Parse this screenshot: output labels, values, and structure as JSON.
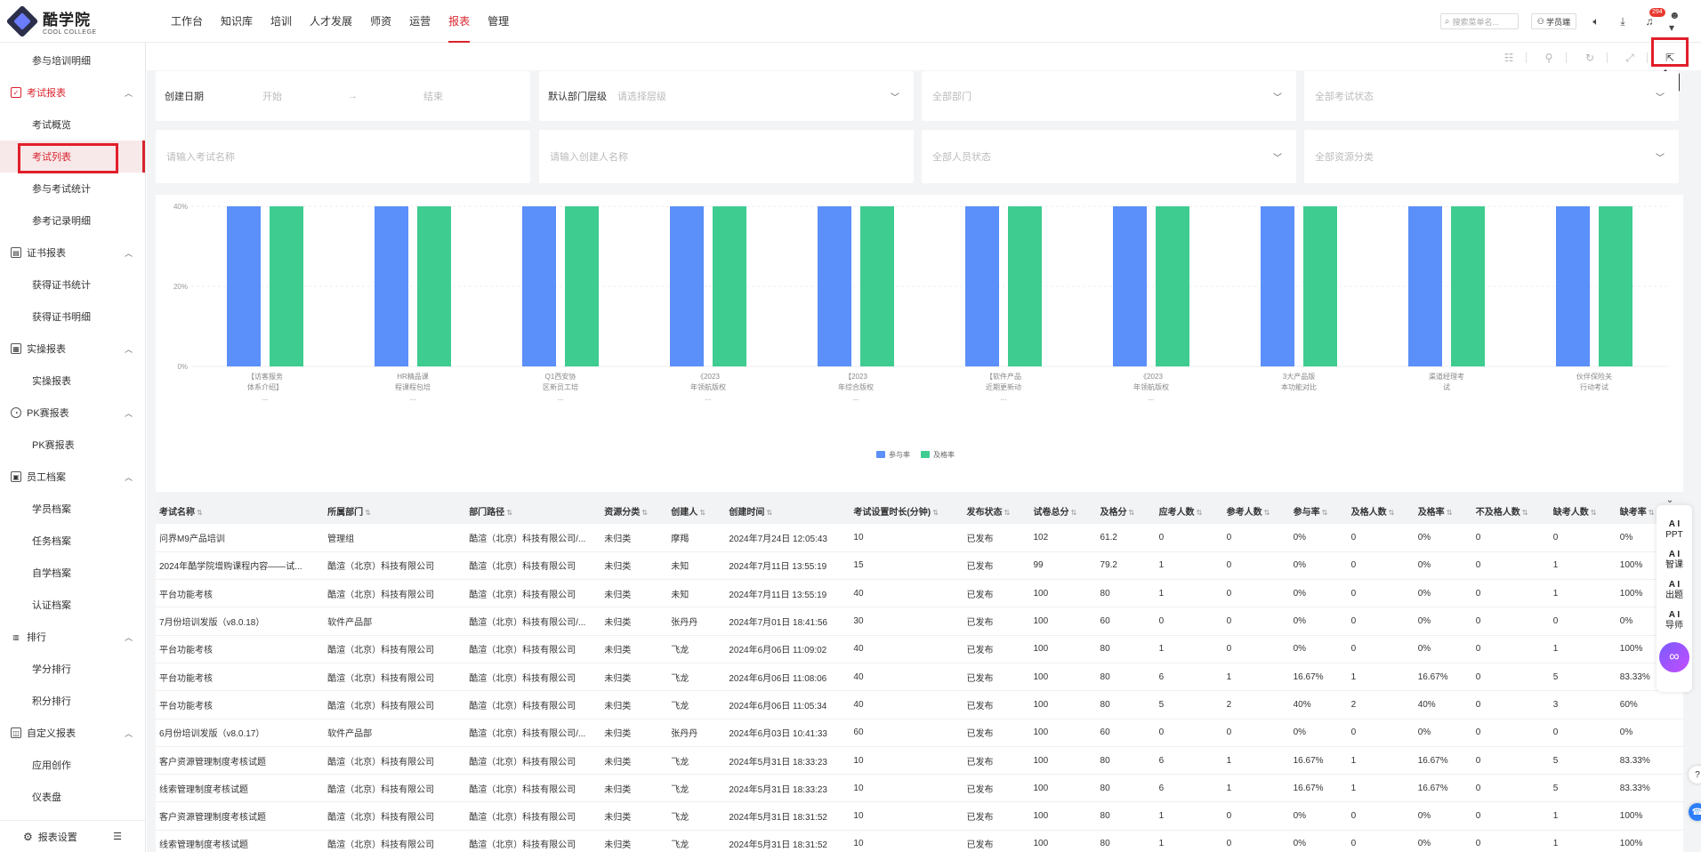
{
  "brand": {
    "name_cn": "酷学院",
    "name_en": "COOL COLLEGE"
  },
  "nav": [
    "工作台",
    "知识库",
    "培训",
    "人才发展",
    "师资",
    "运营",
    "报表",
    "管理"
  ],
  "nav_active": "报表",
  "topright": {
    "search_placeholder": "搜索菜单名...",
    "student_label": "学员端",
    "badge": "294"
  },
  "sidebar": {
    "top_item": "参与培训明细",
    "groups": [
      {
        "label": "考试报表",
        "items": [
          "考试概览",
          "考试列表",
          "参与考试统计",
          "参考记录明细"
        ]
      },
      {
        "label": "证书报表",
        "items": [
          "获得证书统计",
          "获得证书明细"
        ]
      },
      {
        "label": "实操报表",
        "items": [
          "实操报表"
        ]
      },
      {
        "label": "PK赛报表",
        "items": [
          "PK赛报表"
        ]
      },
      {
        "label": "员工档案",
        "items": [
          "学员档案",
          "任务档案",
          "自学档案",
          "认证档案"
        ]
      },
      {
        "label": "排行",
        "items": [
          "学分排行",
          "积分排行"
        ]
      },
      {
        "label": "自定义报表",
        "items": [
          "应用创作",
          "仪表盘"
        ]
      }
    ],
    "footer": "报表设置"
  },
  "toolbar": {
    "tooltip": "导出"
  },
  "filters": {
    "date_label": "创建日期",
    "date_start": "开始",
    "date_sep": "→",
    "date_end": "结束",
    "dept_level_label": "默认部门层级",
    "dept_level_ph": "请选择层级",
    "dept_ph": "全部部门",
    "exam_status_ph": "全部考试状态",
    "exam_name_ph": "请输入考试名称",
    "creator_ph": "请输入创建人名称",
    "person_status_ph": "全部人员状态",
    "resource_ph": "全部资源分类"
  },
  "chart_data": {
    "type": "bar",
    "categories": [
      [
        "【访客服务",
        "体系介绍】",
        "..."
      ],
      [
        "HR精品课",
        "程课程包培",
        "..."
      ],
      [
        "Q1西安协",
        "区新员工培",
        "..."
      ],
      [
        "《2023",
        "年领航版权",
        "..."
      ],
      [
        "【2023",
        "年综合版权",
        "..."
      ],
      [
        "【软件产品",
        "近期更新动",
        "..."
      ],
      [
        "《2023",
        "年领航版权",
        "..."
      ],
      [
        "3大产品版",
        "本功能对比",
        ""
      ],
      [
        "渠道经理考",
        "试",
        ""
      ],
      [
        "伙伴保险关",
        "行动考试",
        ""
      ]
    ],
    "series": [
      {
        "name": "参与率",
        "color": "#5b8ff9",
        "values": [
          40,
          40,
          40,
          40,
          40,
          40,
          40,
          40,
          40,
          40
        ]
      },
      {
        "name": "及格率",
        "color": "#3ecc90",
        "values": [
          40,
          40,
          40,
          40,
          40,
          40,
          40,
          40,
          40,
          40
        ]
      }
    ],
    "yticks": [
      "0%",
      "20%",
      "40%"
    ],
    "ylim": [
      0,
      40
    ]
  },
  "table": {
    "columns": [
      "考试名称",
      "所属部门",
      "部门路径",
      "资源分类",
      "创建人",
      "创建时间",
      "考试设置时长(分钟)",
      "发布状态",
      "试卷总分",
      "及格分",
      "应考人数",
      "参考人数",
      "参与率",
      "及格人数",
      "及格率",
      "不及格人数",
      "缺考人数",
      "缺考率"
    ],
    "rows": [
      [
        "问界M9产品培训",
        "管理组",
        "酷渲（北京）科技有限公司/...",
        "未归类",
        "摩羯",
        "2024年7月24日 12:05:43",
        "10",
        "已发布",
        "102",
        "61.2",
        "0",
        "0",
        "0%",
        "0",
        "0%",
        "0",
        "0",
        "0%"
      ],
      [
        "2024年酷学院增购课程内容——试...",
        "酷渲（北京）科技有限公司",
        "酷渲（北京）科技有限公司",
        "未归类",
        "未知",
        "2024年7月11日 13:55:19",
        "15",
        "已发布",
        "99",
        "79.2",
        "1",
        "0",
        "0%",
        "0",
        "0%",
        "0",
        "1",
        "100%"
      ],
      [
        "平台功能考核",
        "酷渲（北京）科技有限公司",
        "酷渲（北京）科技有限公司",
        "未归类",
        "未知",
        "2024年7月11日 13:55:19",
        "40",
        "已发布",
        "100",
        "80",
        "1",
        "0",
        "0%",
        "0",
        "0%",
        "0",
        "1",
        "100%"
      ],
      [
        "7月份培训发版（v8.0.18）",
        "软件产品部",
        "酷渲（北京）科技有限公司/...",
        "未归类",
        "张丹丹",
        "2024年7月01日 18:41:56",
        "30",
        "已发布",
        "100",
        "60",
        "0",
        "0",
        "0%",
        "0",
        "0%",
        "0",
        "0",
        "0%"
      ],
      [
        "平台功能考核",
        "酷渲（北京）科技有限公司",
        "酷渲（北京）科技有限公司",
        "未归类",
        "飞龙",
        "2024年6月06日 11:09:02",
        "40",
        "已发布",
        "100",
        "80",
        "1",
        "0",
        "0%",
        "0",
        "0%",
        "0",
        "1",
        "100%"
      ],
      [
        "平台功能考核",
        "酷渲（北京）科技有限公司",
        "酷渲（北京）科技有限公司",
        "未归类",
        "飞龙",
        "2024年6月06日 11:08:06",
        "40",
        "已发布",
        "100",
        "80",
        "6",
        "1",
        "16.67%",
        "1",
        "16.67%",
        "0",
        "5",
        "83.33%"
      ],
      [
        "平台功能考核",
        "酷渲（北京）科技有限公司",
        "酷渲（北京）科技有限公司",
        "未归类",
        "飞龙",
        "2024年6月06日 11:05:34",
        "40",
        "已发布",
        "100",
        "80",
        "5",
        "2",
        "40%",
        "2",
        "40%",
        "0",
        "3",
        "60%"
      ],
      [
        "6月份培训发版（v8.0.17）",
        "软件产品部",
        "酷渲（北京）科技有限公司/...",
        "未归类",
        "张丹丹",
        "2024年6月03日 10:41:33",
        "60",
        "已发布",
        "100",
        "60",
        "0",
        "0",
        "0%",
        "0",
        "0%",
        "0",
        "0",
        "0%"
      ],
      [
        "客户资源管理制度考核试题",
        "酷渲（北京）科技有限公司",
        "酷渲（北京）科技有限公司",
        "未归类",
        "飞龙",
        "2024年5月31日 18:33:23",
        "10",
        "已发布",
        "100",
        "80",
        "6",
        "1",
        "16.67%",
        "1",
        "16.67%",
        "0",
        "5",
        "83.33%"
      ],
      [
        "线索管理制度考核试题",
        "酷渲（北京）科技有限公司",
        "酷渲（北京）科技有限公司",
        "未归类",
        "飞龙",
        "2024年5月31日 18:33:23",
        "10",
        "已发布",
        "100",
        "80",
        "6",
        "1",
        "16.67%",
        "1",
        "16.67%",
        "0",
        "5",
        "83.33%"
      ],
      [
        "客户资源管理制度考核试题",
        "酷渲（北京）科技有限公司",
        "酷渲（北京）科技有限公司",
        "未归类",
        "飞龙",
        "2024年5月31日 18:31:52",
        "10",
        "已发布",
        "100",
        "80",
        "1",
        "0",
        "0%",
        "0",
        "0%",
        "0",
        "1",
        "100%"
      ],
      [
        "线索管理制度考核试题",
        "酷渲（北京）科技有限公司",
        "酷渲（北京）科技有限公司",
        "未归类",
        "飞龙",
        "2024年5月31日 18:31:52",
        "10",
        "已发布",
        "100",
        "80",
        "1",
        "0",
        "0%",
        "0",
        "0%",
        "0",
        "1",
        "100%"
      ]
    ]
  },
  "ai_float": [
    {
      "a": "A I",
      "b": "PPT"
    },
    {
      "a": "A I",
      "b": "智课"
    },
    {
      "a": "A I",
      "b": "出题"
    },
    {
      "a": "A I",
      "b": "导师"
    }
  ]
}
